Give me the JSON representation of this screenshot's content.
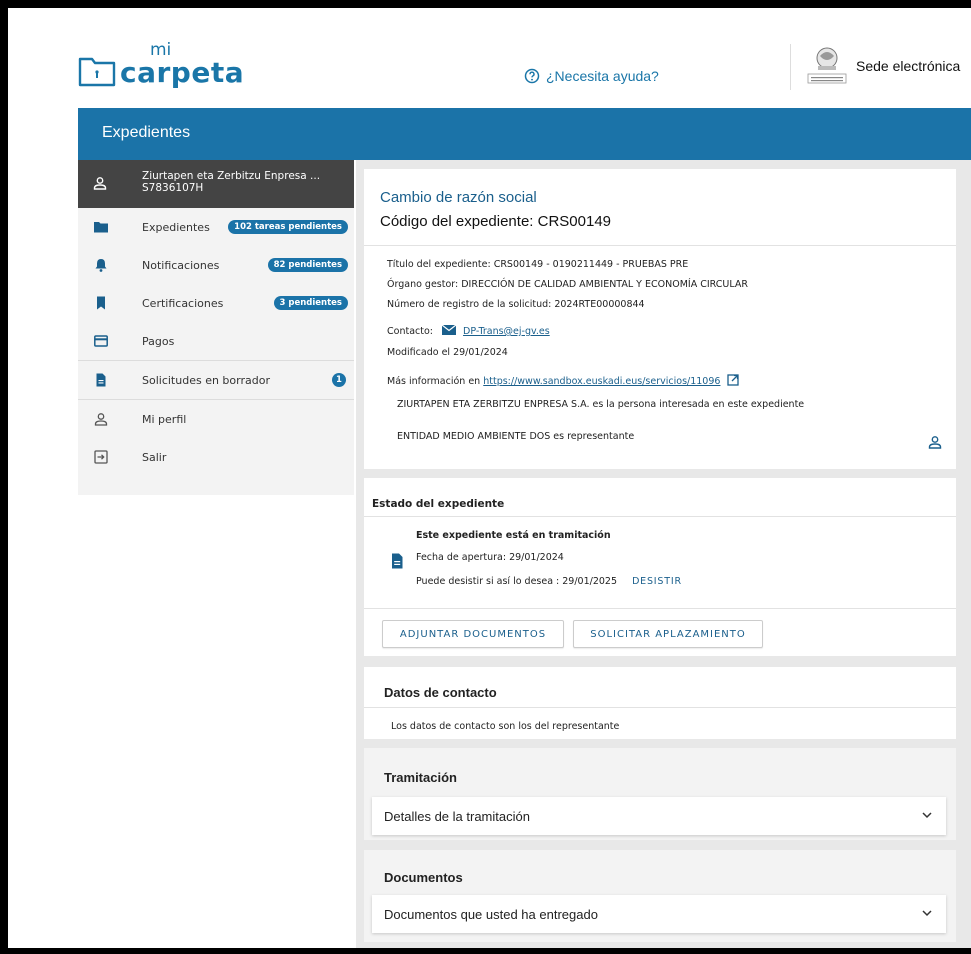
{
  "header": {
    "logo_mi": "mi",
    "logo_carpeta": "carpeta",
    "help_label": "¿Necesita ayuda?",
    "sede_label": "Sede electrónica"
  },
  "bluebar": {
    "title": "Expedientes"
  },
  "sidebar": {
    "user_name": "Ziurtapen eta Zerbitzu Enpresa ...",
    "user_id": "S7836107H",
    "items": [
      {
        "label": "Expedientes",
        "badge": "102 tareas pendientes",
        "icon": "folder-icon"
      },
      {
        "label": "Notificaciones",
        "badge": "82 pendientes",
        "icon": "bell-icon"
      },
      {
        "label": "Certificaciones",
        "badge": "3 pendientes",
        "icon": "bookmark-icon"
      },
      {
        "label": "Pagos",
        "badge": "",
        "icon": "card-icon"
      },
      {
        "label": "Solicitudes en borrador",
        "badge": "1",
        "icon": "document-icon"
      },
      {
        "label": "Mi perfil",
        "badge": "",
        "icon": "user-icon"
      },
      {
        "label": "Salir",
        "badge": "",
        "icon": "logout-icon"
      }
    ]
  },
  "expediente": {
    "title": "Cambio de razón social",
    "code": "Código del expediente: CRS00149",
    "titulo": "Título del expediente: CRS00149 - 0190211449 - PRUEBAS PRE",
    "organo": "Órgano gestor: DIRECCIÓN DE CALIDAD AMBIENTAL Y ECONOMÍA CIRCULAR",
    "registro": "Número de registro de la solicitud: 2024RTE00000844",
    "contacto_label": "Contacto:",
    "contacto_email": "DP-Trans@ej-gv.es",
    "modificado": "Modificado el 29/01/2024",
    "mas_info_label": "Más información en",
    "mas_info_url": "https://www.sandbox.euskadi.eus/servicios/11096",
    "interesada": "ZIURTAPEN ETA ZERBITZU ENPRESA S.A.   es la persona interesada en este expediente",
    "representante": "ENTIDAD MEDIO AMBIENTE DOS es representante"
  },
  "estado": {
    "title": "Estado del expediente",
    "status": "Este expediente está en tramitación",
    "apertura": "Fecha de apertura: 29/01/2024",
    "desistir_text": "Puede desistir si así lo desea : 29/01/2025",
    "desistir_link": "DESISTIR",
    "btn_adjuntar": "ADJUNTAR DOCUMENTOS",
    "btn_aplazamiento": "SOLICITAR APLAZAMIENTO"
  },
  "contacto": {
    "title": "Datos de contacto",
    "text": "Los datos de contacto son los del representante"
  },
  "tramitacion": {
    "title": "Tramitación",
    "accordion": "Detalles de la tramitación"
  },
  "documentos": {
    "title": "Documentos",
    "accordion": "Documentos que usted ha entregado"
  },
  "colors": {
    "brand_blue": "#1b73a8",
    "link_blue": "#1a5f8c",
    "sidebar_dark": "#444444"
  }
}
